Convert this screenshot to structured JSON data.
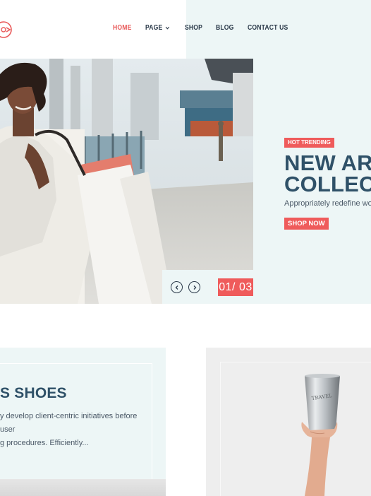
{
  "nav": {
    "items": [
      {
        "label": "HOME",
        "active": true
      },
      {
        "label": "PAGE",
        "dropdown": true
      },
      {
        "label": "SHOP"
      },
      {
        "label": "BLOG"
      },
      {
        "label": "CONTACT US"
      }
    ]
  },
  "hero": {
    "badge": "HOT TRENDING",
    "title_line1": "NEW ARRIVAL",
    "title_line2": "COLLECTION",
    "subtitle": "Appropriately redefine world-class",
    "button": "SHOP NOW",
    "counter": "01/ 03",
    "prev_icon": "chevron-left-icon",
    "next_icon": "chevron-right-icon"
  },
  "cards": {
    "left": {
      "title": "S SHOES",
      "desc_line1": "y develop client-centric initiatives before user",
      "desc_line2": "g procedures. Efficiently..."
    },
    "right": {
      "image": "hand-holding-steel-cup",
      "cup_text": "TRAVEL"
    }
  },
  "colors": {
    "accent": "#ef5b5b",
    "heading": "#2f5168",
    "nav_text": "#2b3a4a",
    "tint": "#edf6f6"
  }
}
